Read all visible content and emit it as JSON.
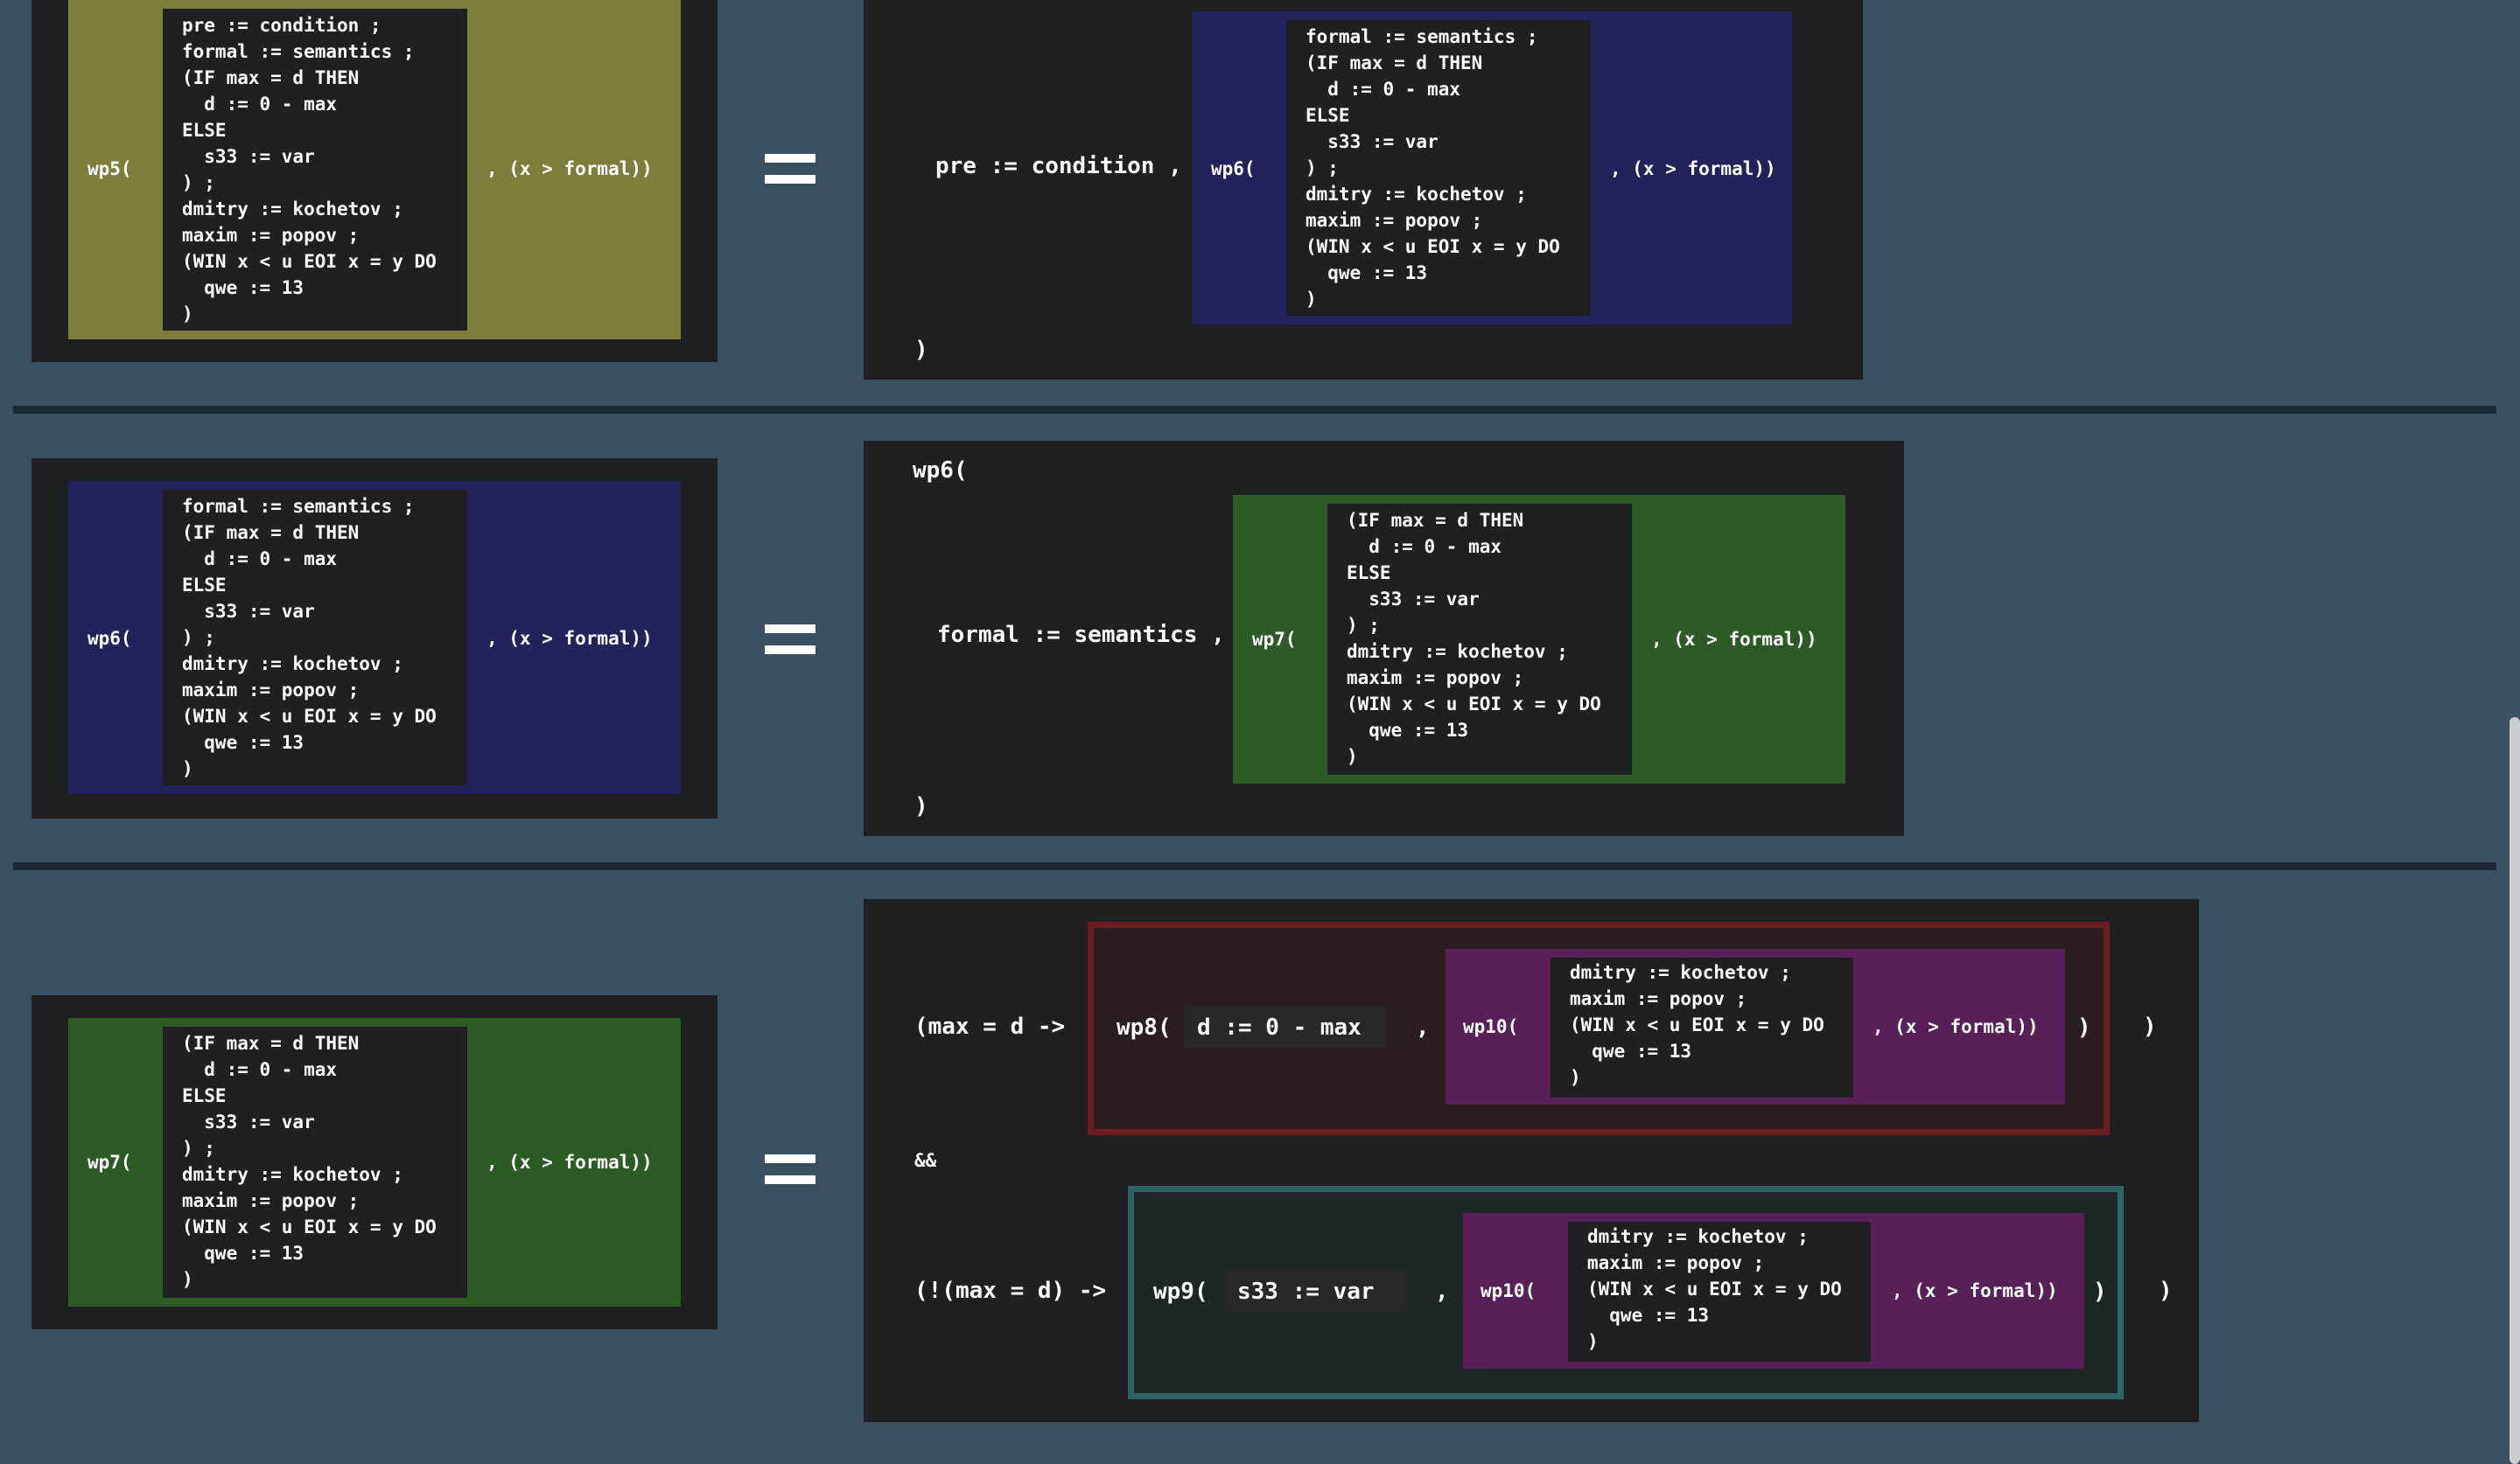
{
  "colors": {
    "background": "#3a5160",
    "panel": "#1f2022",
    "olive": "#7d7d3c",
    "navy": "#23225a",
    "green": "#2b5c24",
    "purple": "#591f59",
    "maroon_border": "#6b1d24",
    "teal_border": "#2d6563",
    "separator": "#1e2a33"
  },
  "icons": [
    "equals-icon"
  ],
  "code_blocks": {
    "full5": "pre := condition ;\nformal := semantics ;\n(IF max = d THEN\n  d := 0 - max\nELSE\n  s33 := var\n) ;\ndmitry := kochetov ;\nmaxim := popov ;\n(WIN x < u EOI x = y DO\n  qwe := 13\n)",
    "full6": "formal := semantics ;\n(IF max = d THEN\n  d := 0 - max\nELSE\n  s33 := var\n) ;\ndmitry := kochetov ;\nmaxim := popov ;\n(WIN x < u EOI x = y DO\n  qwe := 13\n)",
    "full7": "(IF max = d THEN\n  d := 0 - max\nELSE\n  s33 := var\n) ;\ndmitry := kochetov ;\nmaxim := popov ;\n(WIN x < u EOI x = y DO\n  qwe := 13\n)",
    "tail10": "dmitry := kochetov ;\nmaxim := popov ;\n(WIN x < u EOI x = y DO\n  qwe := 13\n)"
  },
  "labels": {
    "wp5": "wp5(",
    "wp6": "wp6(",
    "wp7": "wp7(",
    "wp8": "wp8(",
    "wp9": "wp9(",
    "wp10": "wp10(",
    "post": ", (x > formal))",
    "close": ")",
    "comma": ",",
    "pre_assign": "pre := condition ,",
    "formal_assign": "formal := semantics ,",
    "cond_true": "(max = d ->",
    "cond_false": "(!(max = d) ->",
    "and_op": "&&",
    "d_assign": "d := 0 - max",
    "s33_assign": "s33 := var"
  }
}
